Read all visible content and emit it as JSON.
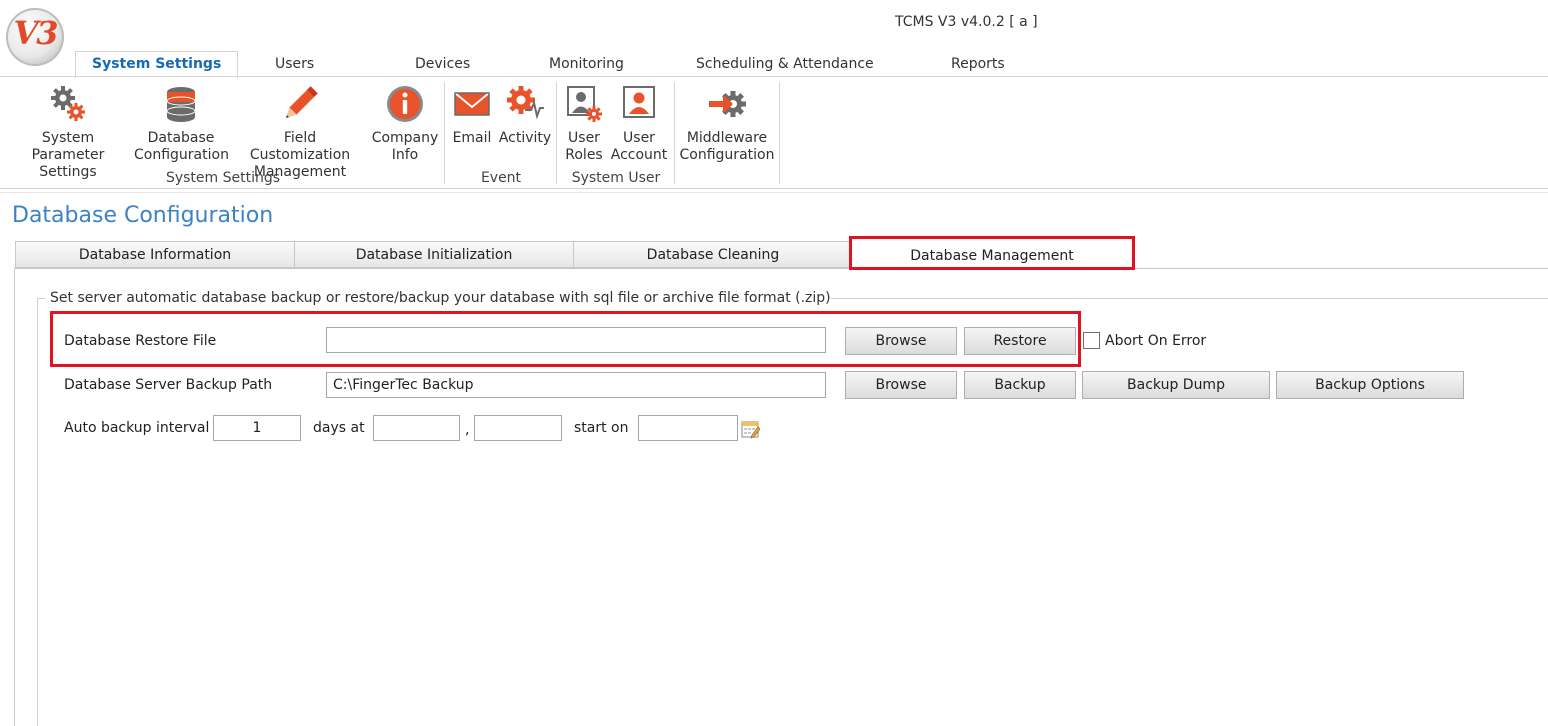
{
  "window": {
    "title": "TCMS V3 v4.0.2 [ a ]",
    "logo_text": "V3"
  },
  "ribbon_tabs": [
    {
      "label": "System Settings",
      "active": true
    },
    {
      "label": "Users"
    },
    {
      "label": "Devices"
    },
    {
      "label": "Monitoring"
    },
    {
      "label": "Scheduling & Attendance"
    },
    {
      "label": "Reports"
    }
  ],
  "ribbon": {
    "buttons": [
      {
        "line1": "System Parameter",
        "line2": "Settings",
        "icon": "gears-icon"
      },
      {
        "line1": "Database",
        "line2": "Configuration",
        "icon": "database-icon"
      },
      {
        "line1": "Field Customization",
        "line2": "Management",
        "icon": "pencil-icon"
      },
      {
        "line1": "Company",
        "line2": "Info",
        "icon": "info-icon"
      },
      {
        "line1": "Email",
        "line2": "",
        "icon": "envelope-icon"
      },
      {
        "line1": "Activity",
        "line2": "",
        "icon": "activity-icon"
      },
      {
        "line1": "User",
        "line2": "Roles",
        "icon": "user-roles-icon"
      },
      {
        "line1": "User",
        "line2": "Account",
        "icon": "user-account-icon"
      },
      {
        "line1": "Middleware",
        "line2": "Configuration",
        "icon": "middleware-icon"
      }
    ],
    "groups": [
      "System Settings",
      "Event",
      "System User"
    ]
  },
  "page": {
    "title": "Database Configuration"
  },
  "content_tabs": [
    {
      "label": "Database Information"
    },
    {
      "label": "Database Initialization"
    },
    {
      "label": "Database Cleaning"
    },
    {
      "label": "Database Management",
      "active": true
    }
  ],
  "groupbox": {
    "caption": "Set server automatic database backup or restore/backup your database with sql file or archive file format (.zip)"
  },
  "restore": {
    "label": "Database Restore File",
    "value": "",
    "browse_label": "Browse",
    "restore_label": "Restore",
    "abort_label": "Abort On Error",
    "abort_checked": false
  },
  "backup": {
    "label": "Database Server Backup Path",
    "value": "C:\\FingerTec Backup",
    "browse_label": "Browse",
    "backup_label": "Backup",
    "dump_label": "Backup Dump",
    "options_label": "Backup Options"
  },
  "auto": {
    "label": "Auto backup interval",
    "interval_value": "1",
    "days_label": "days at",
    "hour_value": "",
    "separator": ",",
    "minute_value": "",
    "start_label": "start on",
    "start_value": ""
  },
  "colors": {
    "accent": "#1569b5",
    "highlight": "#e0141e",
    "icon_orange": "#e8532a",
    "title_blue": "#3d82c4"
  }
}
